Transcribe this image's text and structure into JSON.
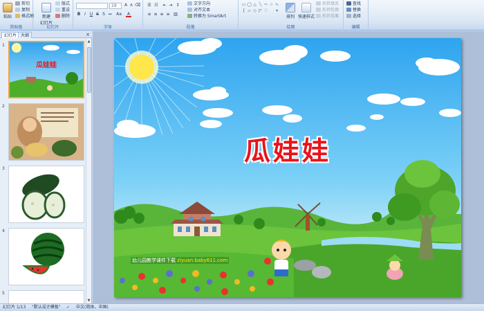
{
  "ribbon": {
    "clipboard": {
      "paste": "粘贴",
      "cut": "剪切",
      "copy": "复制",
      "format_painter": "格式刷",
      "label": "剪贴板"
    },
    "slides": {
      "new_slide": "新建\n幻灯片",
      "layout": "版式",
      "reset": "重设",
      "delete": "删除",
      "label": "幻灯片"
    },
    "font": {
      "name": "",
      "size": "28",
      "label": "字体"
    },
    "paragraph": {
      "text_direction": "文字方向",
      "align_text": "对齐文本",
      "smartart": "转换为 SmartArt",
      "label": "段落"
    },
    "drawing": {
      "arrange": "排列",
      "quick_styles": "快速样式",
      "shape_fill": "形状填充",
      "shape_outline": "形状轮廓",
      "shape_effects": "形状效果",
      "label": "绘图"
    },
    "editing": {
      "find": "查找",
      "replace": "替换",
      "select": "选择",
      "label": "编辑"
    }
  },
  "panel": {
    "tabs": [
      "幻灯片",
      "大纲"
    ],
    "close": "×",
    "thumbnails": [
      {
        "number": "1",
        "title": "瓜娃娃",
        "selected": true
      },
      {
        "number": "2",
        "selected": false
      },
      {
        "number": "3",
        "selected": false
      },
      {
        "number": "4",
        "selected": false
      },
      {
        "number": "5",
        "selected": false
      }
    ]
  },
  "slide": {
    "title": "瓜娃娃",
    "footer_text": "幼儿园教学课件下载",
    "footer_url": "ziyuan.baby611.com"
  },
  "status": {
    "slide_count": "幻灯片 1/13",
    "theme": "\"默认设计模板\"",
    "language": "中文(简体，中国)"
  },
  "colors": {
    "ribbon_bg": "#dbe7f5",
    "selection": "#f5a33b",
    "title_red": "#e8141c",
    "sky": "#2ea4ef",
    "grass": "#4cae2a"
  }
}
